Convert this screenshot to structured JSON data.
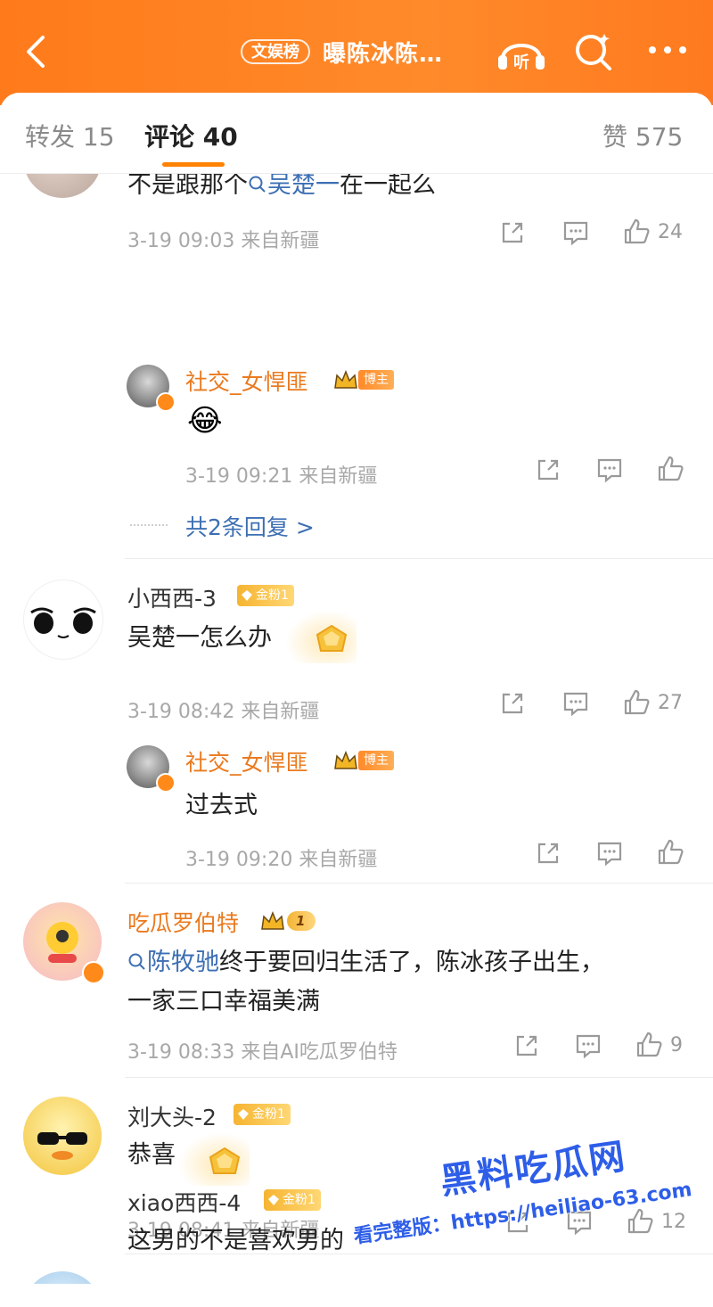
{
  "header": {
    "badge": "文娱榜",
    "title": "曝陈冰陈…",
    "listen_label": "听"
  },
  "tabs": [
    {
      "label": "转发 15"
    },
    {
      "label": "评论 40"
    },
    {
      "label": "赞 575"
    }
  ],
  "comments": [
    {
      "body_prefix": "不是跟那个",
      "body_link": "吴楚一",
      "body_suffix": "在一起么",
      "meta": "3-19 09:03 来自新疆",
      "likes": "24",
      "reply": {
        "name": "社交_女悍匪",
        "badge": "博主",
        "emoji": "😂",
        "meta": "3-19 09:21 来自新疆"
      },
      "more_replies": "共2条回复 >"
    },
    {
      "name": "小西西-3",
      "badge": "金粉1",
      "body": "吴楚一怎么办",
      "meta": "3-19 08:42 来自新疆",
      "likes": "27",
      "reply": {
        "name": "社交_女悍匪",
        "badge": "博主",
        "body": "过去式",
        "meta": "3-19 09:20 来自新疆"
      }
    },
    {
      "name": "吃瓜罗伯特",
      "level": "1",
      "body_link": "陈牧驰",
      "body_line1": "终于要回归生活了，陈冰孩子出生，",
      "body_line2": "一家三口幸福美满",
      "meta": "3-19 08:33 来自AI吃瓜罗伯特",
      "likes": "9"
    },
    {
      "name": "刘大头-2",
      "badge": "金粉1",
      "body": "恭喜",
      "meta": "3-19 08:41 来自新疆",
      "likes": "12"
    },
    {
      "name": "xiao西西-4",
      "badge": "金粉1",
      "body": "这男的不是喜欢男的"
    }
  ],
  "watermark": {
    "title": "黑料吃瓜网",
    "line": "看完整版：https://heiliao-63.com"
  },
  "colors": {
    "accent": "#ff8200",
    "link": "#3d6fb3",
    "username_orange": "#ea7a1f"
  }
}
